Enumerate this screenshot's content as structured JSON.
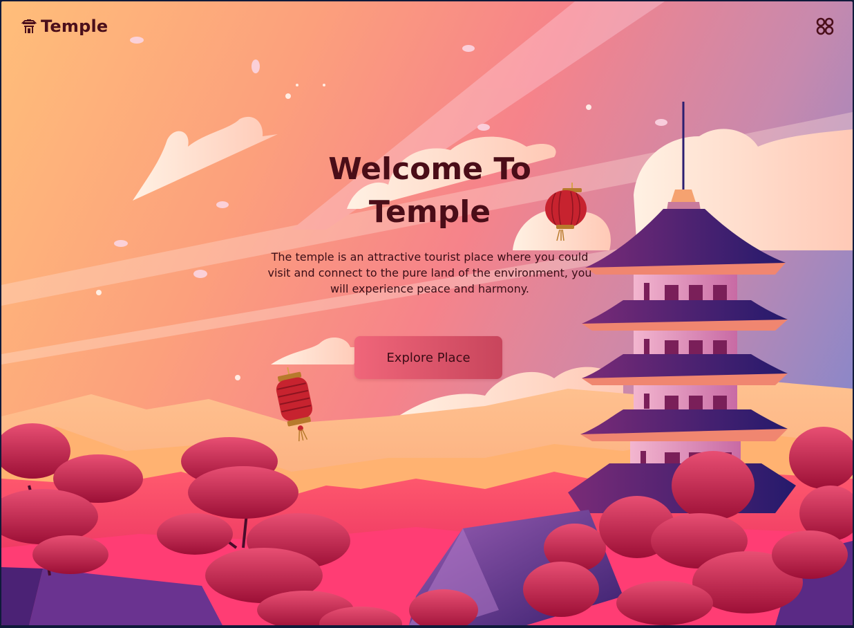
{
  "brand": {
    "name": "Temple",
    "icon": "temple-icon"
  },
  "header": {
    "menu_icon": "grid-menu-icon"
  },
  "hero": {
    "title_line1": "Welcome To",
    "title_line2": "Temple",
    "description": "The temple is an attractive tourist place where you could visit and connect to the pure land of the environment, you will experience peace and harmony.",
    "cta_label": "Explore Place"
  },
  "colors": {
    "text_dark": "#4a0d18",
    "button": "#e25a70",
    "pagoda": "#2e1a6b",
    "trees": "#b8163f"
  }
}
